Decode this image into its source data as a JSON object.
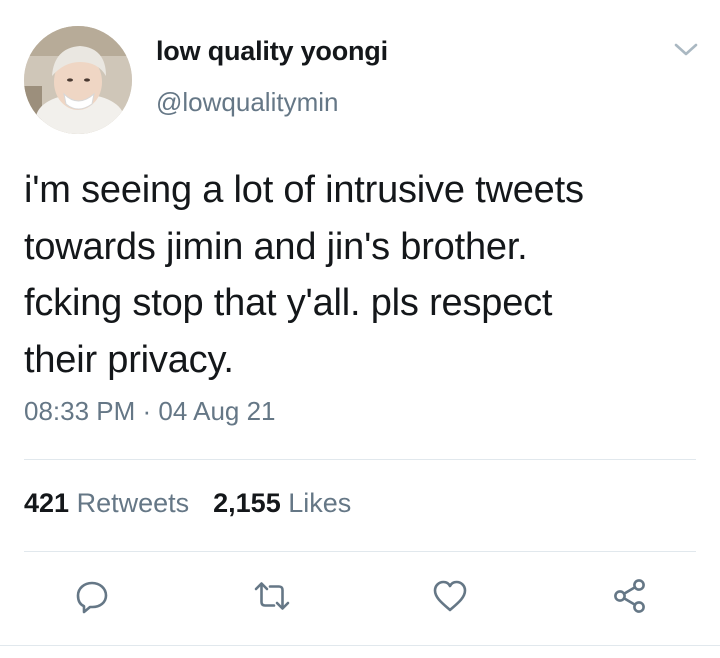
{
  "author": {
    "display_name": "low quality yoongi",
    "handle": "@lowqualitymin"
  },
  "tweet": {
    "text": "i'm seeing a lot of intrusive tweets\ntowards jimin and jin's brother.\nfcking stop that y'all. pls respect\ntheir privacy.",
    "time": "08:33 PM",
    "separator": " · ",
    "date": "04 Aug 21"
  },
  "stats": {
    "retweets_count": "421",
    "retweets_label": "Retweets",
    "likes_count": "2,155",
    "likes_label": "Likes"
  },
  "icons": {
    "menu": "chevron-down-icon",
    "reply": "reply-icon",
    "retweet": "retweet-icon",
    "like": "heart-icon",
    "share": "share-icon"
  },
  "colors": {
    "text": "#14171a",
    "secondary": "#657786",
    "divider": "#e1e8ed",
    "icon": "#657786"
  }
}
